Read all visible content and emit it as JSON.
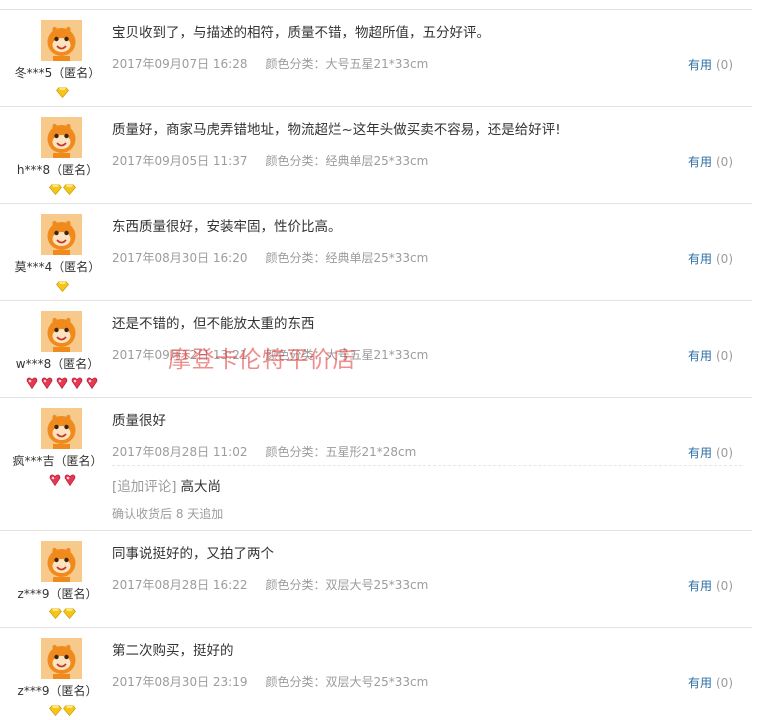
{
  "useful_label": "有用",
  "useful_count": "(0)",
  "colors": {
    "link": "#2b6ea3",
    "meta": "#9c9c9c",
    "watermark": "#e02d2d",
    "gem_yellow": "#f5c518",
    "gem_red": "#e8384f"
  },
  "reviews": [
    {
      "user": "冬***5（匿名）",
      "comment": "宝贝收到了，与描述的相符，质量不错，物超所值，五分好评。",
      "date": "2017年09月07日 16:28",
      "sku": "颜色分类：大号五星21*33cm",
      "gems": {
        "type": "yellow",
        "count": 1
      }
    },
    {
      "user": "h***8（匿名）",
      "comment": "质量好，商家马虎弄错地址，物流超烂~这年头做买卖不容易，还是给好评!",
      "date": "2017年09月05日 11:37",
      "sku": "颜色分类：经典单层25*33cm",
      "gems": {
        "type": "yellow",
        "count": 2
      }
    },
    {
      "user": "莫***4（匿名）",
      "comment": "东西质量很好，安装牢固，性价比高。",
      "date": "2017年08月30日 16:20",
      "sku": "颜色分类：经典单层25*33cm",
      "gems": {
        "type": "yellow",
        "count": 1
      }
    },
    {
      "user": "w***8（匿名）",
      "comment": "还是不错的，但不能放太重的东西",
      "date": "2017年09月12日 13:21",
      "sku": "颜色分类：大号五星21*33cm",
      "gems": {
        "type": "red",
        "count": 5
      }
    },
    {
      "user": "疯***吉（匿名）",
      "comment": "质量很好",
      "date": "2017年08月28日 11:02",
      "sku": "颜色分类：五星形21*28cm",
      "gems": {
        "type": "red",
        "count": 2
      },
      "append": {
        "tag": "[追加评论]",
        "text": "高大尚",
        "note": "确认收货后 8 天追加"
      }
    },
    {
      "user": "z***9（匿名）",
      "comment": "同事说挺好的，又拍了两个",
      "date": "2017年08月28日 16:22",
      "sku": "颜色分类：双层大号25*33cm",
      "gems": {
        "type": "yellow",
        "count": 2
      }
    },
    {
      "user": "z***9（匿名）",
      "comment": "第二次购买，挺好的",
      "date": "2017年08月30日 23:19",
      "sku": "颜色分类：双层大号25*33cm",
      "gems": {
        "type": "yellow",
        "count": 2
      }
    }
  ],
  "watermark": "摩登卡伦特平价店"
}
